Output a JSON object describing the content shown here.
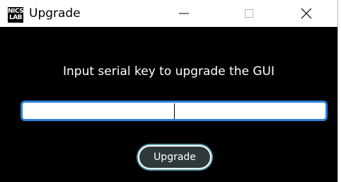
{
  "window": {
    "title": "Upgrade",
    "logo_line1": "NICS",
    "logo_line2": "LAB",
    "controls": {
      "minimize": "minimize-icon",
      "maximize": "maximize-icon",
      "close": "close-icon"
    }
  },
  "content": {
    "prompt": "Input serial key to upgrade the GUI",
    "serial_input": {
      "value": "",
      "placeholder": ""
    },
    "upgrade_button_label": "Upgrade"
  },
  "colors": {
    "background": "#000000",
    "input_border": "#2f7fd8",
    "button_fill": "#2e3a3a",
    "button_ring": "#5a9fb0"
  }
}
